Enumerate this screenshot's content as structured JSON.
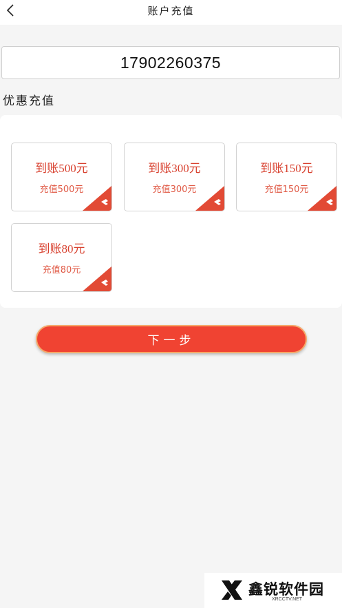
{
  "header": {
    "title": "账户充值"
  },
  "account": {
    "phone": "17902260375"
  },
  "section": {
    "title": "优惠充值"
  },
  "options": [
    {
      "main": "到账500元",
      "sub": "充值500元"
    },
    {
      "main": "到账300元",
      "sub": "充值300元"
    },
    {
      "main": "到账150元",
      "sub": "充值150元"
    },
    {
      "main": "到账80元",
      "sub": "充值80元"
    }
  ],
  "actions": {
    "next": "下一步"
  },
  "watermark": {
    "brand": "鑫锐软件园",
    "url": "XRCCTV.NET"
  },
  "colors": {
    "accent": "#f04332",
    "card_text": "#d8412f",
    "background": "#f5f5f5"
  }
}
